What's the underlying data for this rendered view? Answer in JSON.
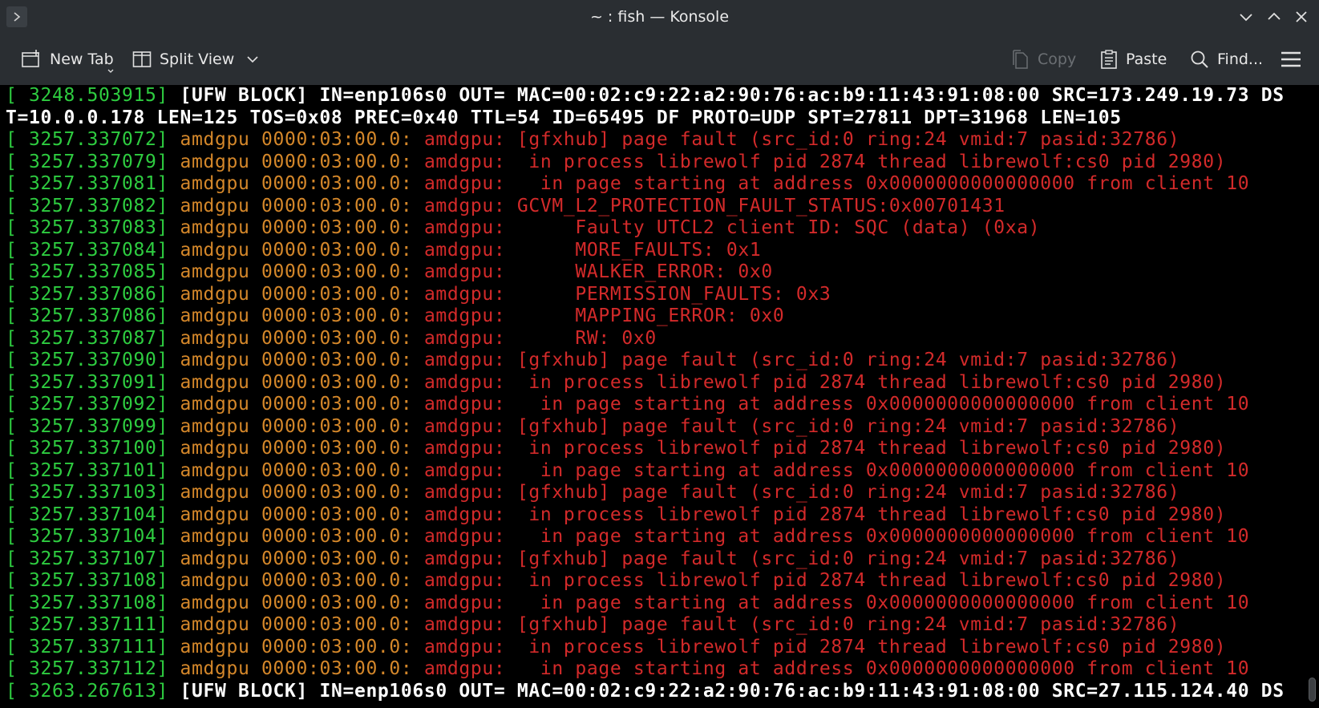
{
  "window": {
    "title": "~ : fish — Konsole"
  },
  "toolbar": {
    "new_tab": "New Tab",
    "split_view": "Split View",
    "copy": "Copy",
    "paste": "Paste",
    "find": "Find..."
  },
  "icons": {
    "menu": "hamburger-menu-icon",
    "new_tab": "new-tab-icon",
    "split_view": "split-view-icon",
    "copy": "copy-icon",
    "paste": "paste-icon",
    "find": "search-icon"
  },
  "colors": {
    "timestamp": "#2ecc40",
    "device": "#d4872a",
    "message": "#d32a2a",
    "ufw": "#ffffff"
  },
  "terminal": {
    "lines": [
      {
        "ts": "3248.503915",
        "kind": "ufw",
        "text": "[UFW BLOCK] IN=enp106s0 OUT= MAC=00:02:c9:22:a2:90:76:ac:b9:11:43:91:08:00 SRC=173.249.19.73 DS"
      },
      {
        "ts": "",
        "kind": "wrap",
        "text": "T=10.0.0.178 LEN=125 TOS=0x08 PREC=0x40 TTL=54 ID=65495 DF PROTO=UDP SPT=27811 DPT=31968 LEN=105"
      },
      {
        "ts": "3257.337072",
        "kind": "amd",
        "text": "amdgpu: [gfxhub] page fault (src_id:0 ring:24 vmid:7 pasid:32786)"
      },
      {
        "ts": "3257.337079",
        "kind": "amd",
        "text": "amdgpu:  in process librewolf pid 2874 thread librewolf:cs0 pid 2980)"
      },
      {
        "ts": "3257.337081",
        "kind": "amd",
        "text": "amdgpu:   in page starting at address 0x0000000000000000 from client 10"
      },
      {
        "ts": "3257.337082",
        "kind": "amd",
        "text": "amdgpu: GCVM_L2_PROTECTION_FAULT_STATUS:0x00701431"
      },
      {
        "ts": "3257.337083",
        "kind": "amd",
        "text": "amdgpu:      Faulty UTCL2 client ID: SQC (data) (0xa)"
      },
      {
        "ts": "3257.337084",
        "kind": "amd",
        "text": "amdgpu:      MORE_FAULTS: 0x1"
      },
      {
        "ts": "3257.337085",
        "kind": "amd",
        "text": "amdgpu:      WALKER_ERROR: 0x0"
      },
      {
        "ts": "3257.337086",
        "kind": "amd",
        "text": "amdgpu:      PERMISSION_FAULTS: 0x3"
      },
      {
        "ts": "3257.337086",
        "kind": "amd",
        "text": "amdgpu:      MAPPING_ERROR: 0x0"
      },
      {
        "ts": "3257.337087",
        "kind": "amd",
        "text": "amdgpu:      RW: 0x0"
      },
      {
        "ts": "3257.337090",
        "kind": "amd",
        "text": "amdgpu: [gfxhub] page fault (src_id:0 ring:24 vmid:7 pasid:32786)"
      },
      {
        "ts": "3257.337091",
        "kind": "amd",
        "text": "amdgpu:  in process librewolf pid 2874 thread librewolf:cs0 pid 2980)"
      },
      {
        "ts": "3257.337092",
        "kind": "amd",
        "text": "amdgpu:   in page starting at address 0x0000000000000000 from client 10"
      },
      {
        "ts": "3257.337099",
        "kind": "amd",
        "text": "amdgpu: [gfxhub] page fault (src_id:0 ring:24 vmid:7 pasid:32786)"
      },
      {
        "ts": "3257.337100",
        "kind": "amd",
        "text": "amdgpu:  in process librewolf pid 2874 thread librewolf:cs0 pid 2980)"
      },
      {
        "ts": "3257.337101",
        "kind": "amd",
        "text": "amdgpu:   in page starting at address 0x0000000000000000 from client 10"
      },
      {
        "ts": "3257.337103",
        "kind": "amd",
        "text": "amdgpu: [gfxhub] page fault (src_id:0 ring:24 vmid:7 pasid:32786)"
      },
      {
        "ts": "3257.337104",
        "kind": "amd",
        "text": "amdgpu:  in process librewolf pid 2874 thread librewolf:cs0 pid 2980)"
      },
      {
        "ts": "3257.337104",
        "kind": "amd",
        "text": "amdgpu:   in page starting at address 0x0000000000000000 from client 10"
      },
      {
        "ts": "3257.337107",
        "kind": "amd",
        "text": "amdgpu: [gfxhub] page fault (src_id:0 ring:24 vmid:7 pasid:32786)"
      },
      {
        "ts": "3257.337108",
        "kind": "amd",
        "text": "amdgpu:  in process librewolf pid 2874 thread librewolf:cs0 pid 2980)"
      },
      {
        "ts": "3257.337108",
        "kind": "amd",
        "text": "amdgpu:   in page starting at address 0x0000000000000000 from client 10"
      },
      {
        "ts": "3257.337111",
        "kind": "amd",
        "text": "amdgpu: [gfxhub] page fault (src_id:0 ring:24 vmid:7 pasid:32786)"
      },
      {
        "ts": "3257.337111",
        "kind": "amd",
        "text": "amdgpu:  in process librewolf pid 2874 thread librewolf:cs0 pid 2980)"
      },
      {
        "ts": "3257.337112",
        "kind": "amd",
        "text": "amdgpu:   in page starting at address 0x0000000000000000 from client 10"
      },
      {
        "ts": "3263.267613",
        "kind": "ufw",
        "text": "[UFW BLOCK] IN=enp106s0 OUT= MAC=00:02:c9:22:a2:90:76:ac:b9:11:43:91:08:00 SRC=27.115.124.40 DS"
      }
    ],
    "device_prefix": "amdgpu 0000:03:00.0:"
  }
}
